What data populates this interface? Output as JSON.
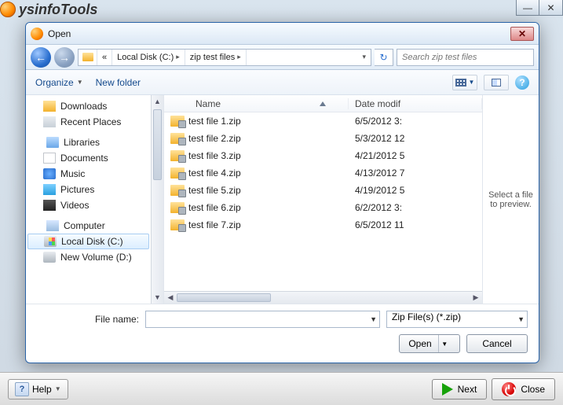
{
  "parent": {
    "logo_text": "ysinfoTools",
    "help_label": "Help",
    "next_label": "Next",
    "close_label": "Close"
  },
  "dialog": {
    "title": "Open",
    "breadcrumb": {
      "prefix": "«",
      "seg1": "Local Disk (C:)",
      "seg2": "zip test files"
    },
    "search_placeholder": "Search zip test files",
    "toolbar": {
      "organize": "Organize",
      "newfolder": "New folder"
    },
    "sidebar": {
      "downloads": "Downloads",
      "recent": "Recent Places",
      "libraries": "Libraries",
      "documents": "Documents",
      "music": "Music",
      "pictures": "Pictures",
      "videos": "Videos",
      "computer": "Computer",
      "localdisk": "Local Disk (C:)",
      "newvolume": "New Volume (D:)"
    },
    "columns": {
      "name": "Name",
      "date": "Date modif"
    },
    "files": [
      {
        "name": "test file 1.zip",
        "date": "6/5/2012 3:"
      },
      {
        "name": "test file 2.zip",
        "date": "5/3/2012 12"
      },
      {
        "name": "test file 3.zip",
        "date": "4/21/2012 5"
      },
      {
        "name": "test file 4.zip",
        "date": "4/13/2012 7"
      },
      {
        "name": "test file 5.zip",
        "date": "4/19/2012 5"
      },
      {
        "name": "test file 6.zip",
        "date": "6/2/2012 3:"
      },
      {
        "name": "test file 7.zip",
        "date": "6/5/2012 11"
      }
    ],
    "preview_text": "Select a file to preview.",
    "filename_label": "File name:",
    "filename_value": "",
    "filter": "Zip File(s) (*.zip)",
    "open_btn": "Open",
    "cancel_btn": "Cancel"
  }
}
